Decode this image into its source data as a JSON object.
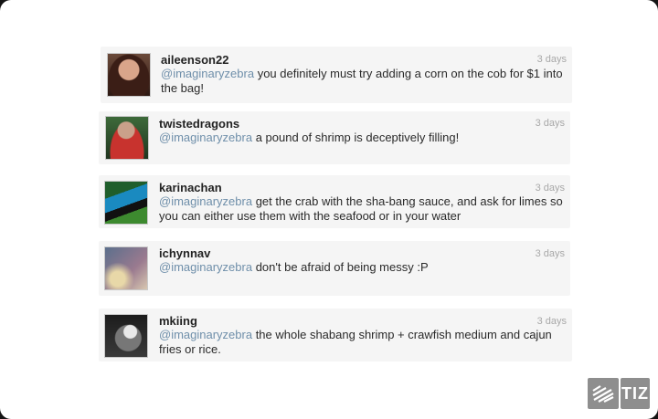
{
  "tweets": [
    {
      "user": "aileenson22",
      "time": "3 days",
      "mention": "@imaginaryzebra",
      "text_line1": " you definitely must try adding a corn on the cob for $1 into",
      "text_line2": "the bag!"
    },
    {
      "user": "twistedragons",
      "time": "3 days",
      "mention": "@imaginaryzebra",
      "text_line1": " a pound of shrimp is deceptively filling!",
      "text_line2": ""
    },
    {
      "user": "karinachan",
      "time": "3 days",
      "mention": "@imaginaryzebra",
      "text_line1": " get the crab with the sha-bang sauce, and ask for limes so",
      "text_line2": "you can either use them with the seafood or in your water"
    },
    {
      "user": "ichynnav",
      "time": "3 days",
      "mention": "@imaginaryzebra",
      "text_line1": " don't be afraid of being messy :P",
      "text_line2": ""
    },
    {
      "user": "mkiing",
      "time": "3 days",
      "mention": "@imaginaryzebra",
      "text_line1": " the whole shabang shrimp + crawfish medium and cajun",
      "text_line2": "fries or rice."
    }
  ],
  "logo": {
    "text": "TIZ",
    "icon": "stripes-logo-icon"
  },
  "colors": {
    "mention": "#6f8faa",
    "card_bg": "#f5f5f5",
    "time": "#a8a8a8"
  }
}
